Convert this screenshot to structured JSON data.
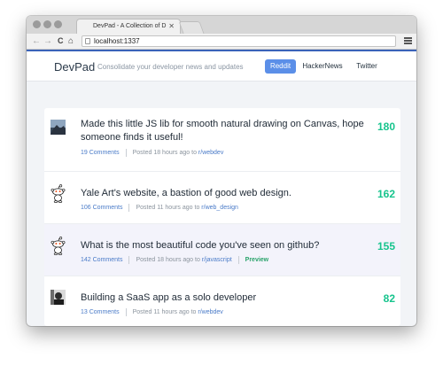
{
  "browser": {
    "tab_title": "DevPad - A Collection of D",
    "tab_close": "✕",
    "url": "localhost:1337",
    "back_glyph": "←",
    "forward_glyph": "→",
    "reload_glyph": "C",
    "home_glyph": "⌂"
  },
  "header": {
    "brand": "DevPad",
    "tagline": "Consolidate your developer news and updates",
    "nav": [
      {
        "label": "Reddit",
        "active": true
      },
      {
        "label": "HackerNews",
        "active": false
      },
      {
        "label": "Twitter",
        "active": false
      }
    ]
  },
  "posts": [
    {
      "title": "Made this little JS lib for smooth natural drawing on Canvas, hope someone finds it useful!",
      "comments": "19 Comments",
      "posted": "Posted 18 hours ago to",
      "subreddit": "r/webdev",
      "score": "180",
      "thumb_icon": "photo-thumbnail-icon"
    },
    {
      "title": "Yale Art's website, a bastion of good web design.",
      "comments": "106 Comments",
      "posted": "Posted 11 hours ago to",
      "subreddit": "r/web_design",
      "score": "162",
      "thumb_icon": "reddit-alien-icon"
    },
    {
      "title": "What is the most beautiful code you've seen on github?",
      "comments": "142 Comments",
      "posted": "Posted 18 hours ago to",
      "subreddit": "r/javascript",
      "preview": "Preview",
      "score": "155",
      "thumb_icon": "reddit-alien-icon"
    },
    {
      "title": "Building a SaaS app as a solo developer",
      "comments": "13 Comments",
      "posted": "Posted 11 hours ago to",
      "subreddit": "r/webdev",
      "score": "82",
      "thumb_icon": "photo-thumbnail-icon"
    }
  ],
  "colors": {
    "accent_blue": "#5b8fe8",
    "score_green": "#17c48d",
    "link_blue": "#4a7bc8",
    "preview_green": "#2aa36b"
  }
}
